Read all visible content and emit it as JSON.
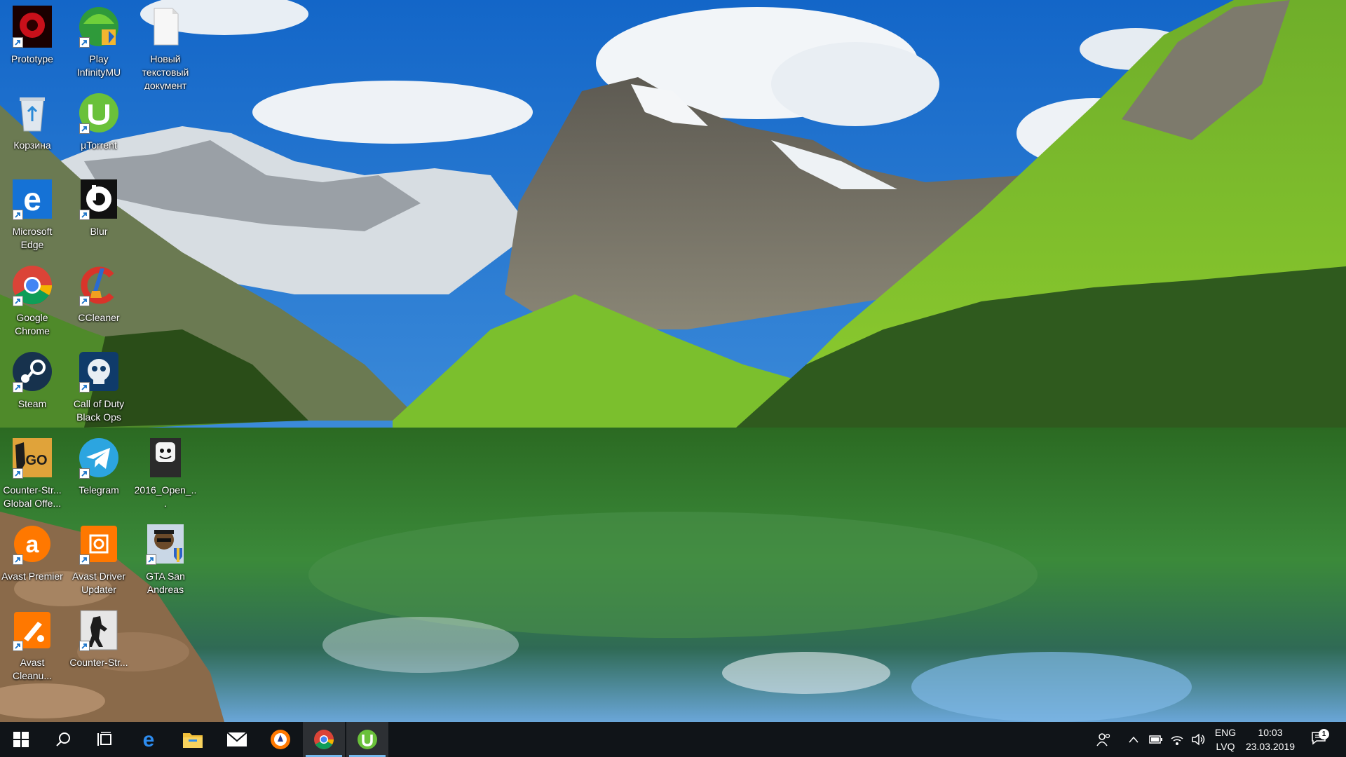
{
  "colors": {
    "taskbar_bg": "#101418",
    "taskbar_active": "#76b9ed",
    "sky": "#1f7fd6",
    "lake": "#2f6f38"
  },
  "desktop": {
    "icons": [
      {
        "label": "Prototype",
        "icon": "prototype-game-icon"
      },
      {
        "label": "Play InfinityMU",
        "icon": "play-infinitymu-icon"
      },
      {
        "label": "Новый текстовый документ",
        "icon": "text-document-icon"
      },
      {
        "label": "Корзина",
        "icon": "recycle-bin-icon"
      },
      {
        "label": "µTorrent",
        "icon": "utorrent-icon"
      },
      {
        "label": "Microsoft Edge",
        "icon": "edge-icon"
      },
      {
        "label": "Blur",
        "icon": "blur-game-icon"
      },
      {
        "label": "Google Chrome",
        "icon": "chrome-icon"
      },
      {
        "label": "CCleaner",
        "icon": "ccleaner-icon"
      },
      {
        "label": "Steam",
        "icon": "steam-icon"
      },
      {
        "label": "Call of Duty Black Ops",
        "icon": "call-of-duty-icon"
      },
      {
        "label": "Counter-Str... Global Offe...",
        "icon": "csgo-icon"
      },
      {
        "label": "Telegram",
        "icon": "telegram-icon"
      },
      {
        "label": "2016_Open_...",
        "icon": "marshmello-file-icon"
      },
      {
        "label": "Avast Premier",
        "icon": "avast-premier-icon"
      },
      {
        "label": "Avast Driver Updater",
        "icon": "avast-driver-updater-icon"
      },
      {
        "label": "GTA San Andreas",
        "icon": "gta-sa-icon"
      },
      {
        "label": "Avast Cleanu...",
        "icon": "avast-cleanup-icon"
      },
      {
        "label": "Counter-Str...",
        "icon": "counter-strike-icon"
      }
    ]
  },
  "taskbar": {
    "pinned": [
      {
        "icon": "windows-start-icon"
      },
      {
        "icon": "search-icon"
      },
      {
        "icon": "task-view-icon"
      },
      {
        "icon": "edge-icon"
      },
      {
        "icon": "file-explorer-icon"
      },
      {
        "icon": "mail-icon"
      },
      {
        "icon": "avast-browser-icon"
      },
      {
        "icon": "chrome-icon"
      },
      {
        "icon": "utorrent-icon"
      }
    ],
    "tray": {
      "lang_line1": "ENG",
      "lang_line2": "LVQ",
      "time": "10:03",
      "date": "23.03.2019",
      "notifications": "1"
    }
  }
}
